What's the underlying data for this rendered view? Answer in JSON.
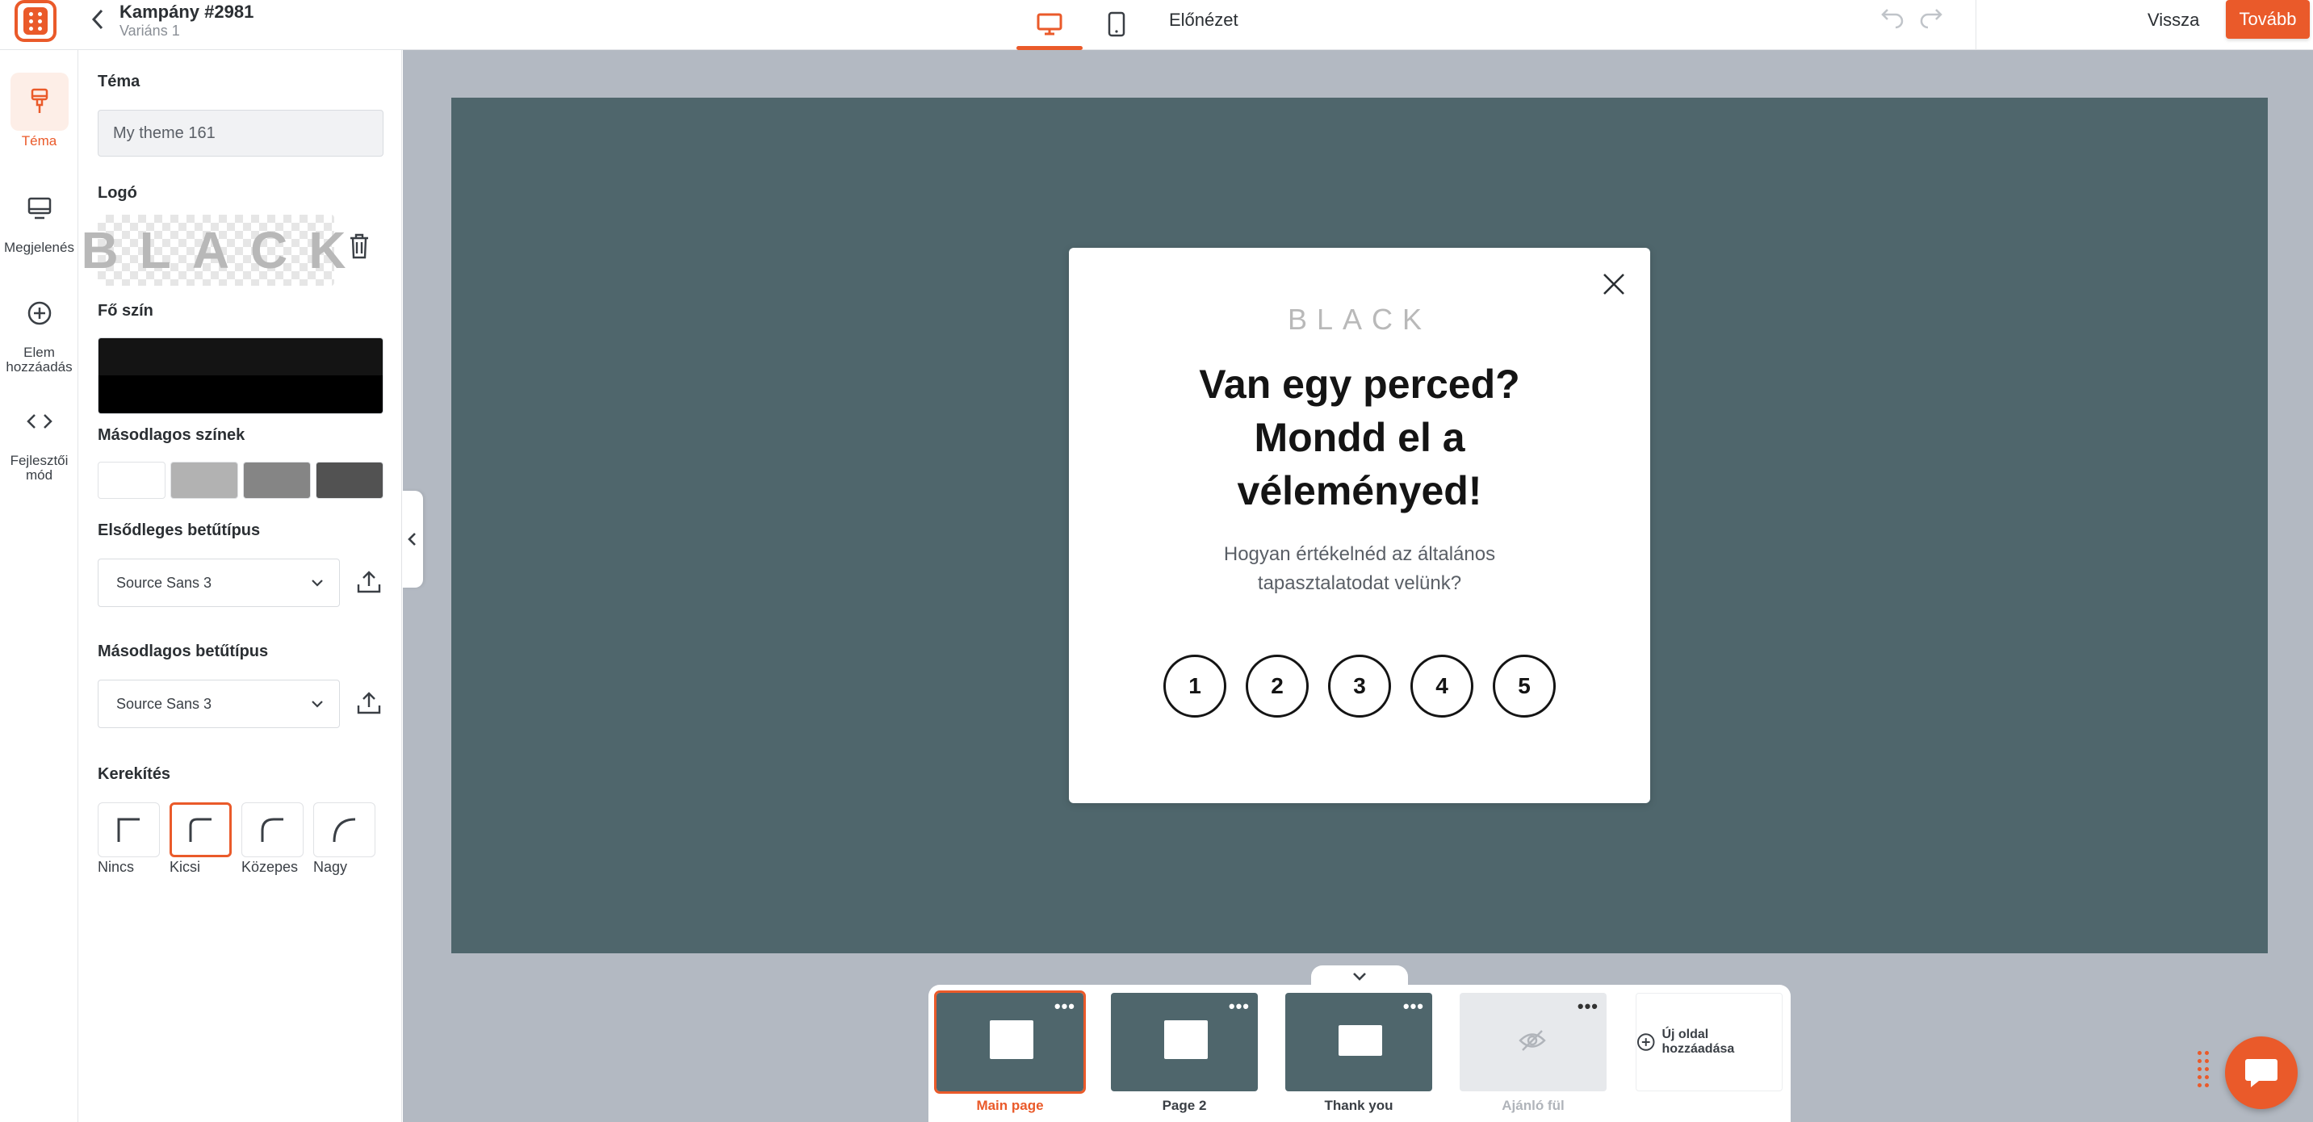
{
  "header": {
    "campaign_title": "Kampány #2981",
    "variant": "Variáns 1",
    "preview_label": "Előnézet",
    "back_label": "Vissza",
    "next_label": "Tovább"
  },
  "rail": [
    {
      "label": "Téma",
      "icon": "brush-icon",
      "active": true
    },
    {
      "label": "Megjelenés",
      "icon": "monitor-icon"
    },
    {
      "label": "Elem hozzáadás",
      "icon": "plus-circle-icon"
    },
    {
      "label": "Fejlesztői mód",
      "icon": "code-icon"
    }
  ],
  "panel": {
    "theme_label": "Téma",
    "theme_value": "My theme 161",
    "logo_label": "Logó",
    "logo_text": "BLACK",
    "main_color_label": "Fő szín",
    "main_color": "#000000",
    "secondary_colors_label": "Másodlagos színek",
    "secondary_colors": [
      "#ffffff",
      "#b2b2b2",
      "#858585",
      "#525252"
    ],
    "primary_font_label": "Elsődleges betűtípus",
    "primary_font": "Source Sans 3",
    "secondary_font_label": "Másodlagos betűtípus",
    "secondary_font": "Source Sans 3",
    "rounding_label": "Kerekítés",
    "rounding_options": [
      "Nincs",
      "Kicsi",
      "Közepes",
      "Nagy"
    ],
    "rounding_selected": "Kicsi"
  },
  "popup": {
    "logo_text": "BLACK",
    "headline": "Van egy perced? Mondd el a véleményed!",
    "body": "Hogyan értékelnéd az általános tapasztalatodat velünk?",
    "ratings": [
      "1",
      "2",
      "3",
      "4",
      "5"
    ]
  },
  "pages": {
    "items": [
      {
        "label": "Main page",
        "selected": true
      },
      {
        "label": "Page 2"
      },
      {
        "label": "Thank you"
      },
      {
        "label": "Ajánló fül",
        "hidden": true
      }
    ],
    "add_label": "Új oldal hozzáadása"
  },
  "colors": {
    "accent": "#ea5a2a",
    "stage": "#4f666c",
    "canvas": "#b3b9c2"
  }
}
